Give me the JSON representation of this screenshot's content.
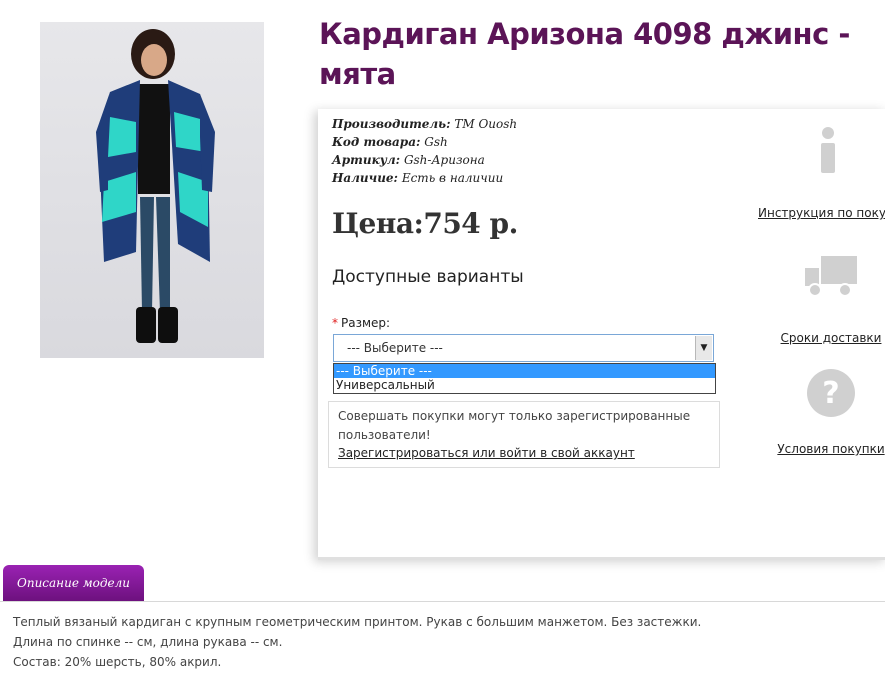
{
  "product": {
    "title": "Кардиган Аризона 4098 джинс - мята",
    "image_alt": "cardigan-photo"
  },
  "meta": {
    "manufacturer_key": "Производитель:",
    "manufacturer_val": "ТМ Ouosh",
    "code_key": "Код товара:",
    "code_val": "Gsh",
    "article_key": "Артикул:",
    "article_val": "Gsh-Аризона",
    "stock_key": "Наличие:",
    "stock_val": "Есть в наличии"
  },
  "price": "Цена:754 р.",
  "variants_heading": "Доступные варианты",
  "size": {
    "required_mark": "*",
    "label": "Размер:",
    "selected": "--- Выберите ---",
    "options": [
      "--- Выберите ---",
      "Универсальный"
    ]
  },
  "notice": {
    "text": "Совершать покупки могут только зарегистрированные пользователи!",
    "link": "Зарегистрироваться или войти в свой аккаунт"
  },
  "side_links": {
    "instructions": "Инструкция по покупке",
    "delivery": "Сроки доставки",
    "terms": "Условия покупки"
  },
  "tabs": {
    "description": "Описание модели"
  },
  "description": {
    "line1": "Теплый вязаный кардиган с крупным геометрическим принтом. Рукав с большим манжетом. Без застежки.",
    "line2": "Длина по спинке -- см, длина рукава -- см.",
    "line3": "Состав: 20% шерсть, 80% акрил."
  },
  "colors": {
    "title": "#5b1457",
    "tab": "#8a1aa0",
    "icon_gray": "#d0d0d0",
    "selection": "#3399ff"
  }
}
